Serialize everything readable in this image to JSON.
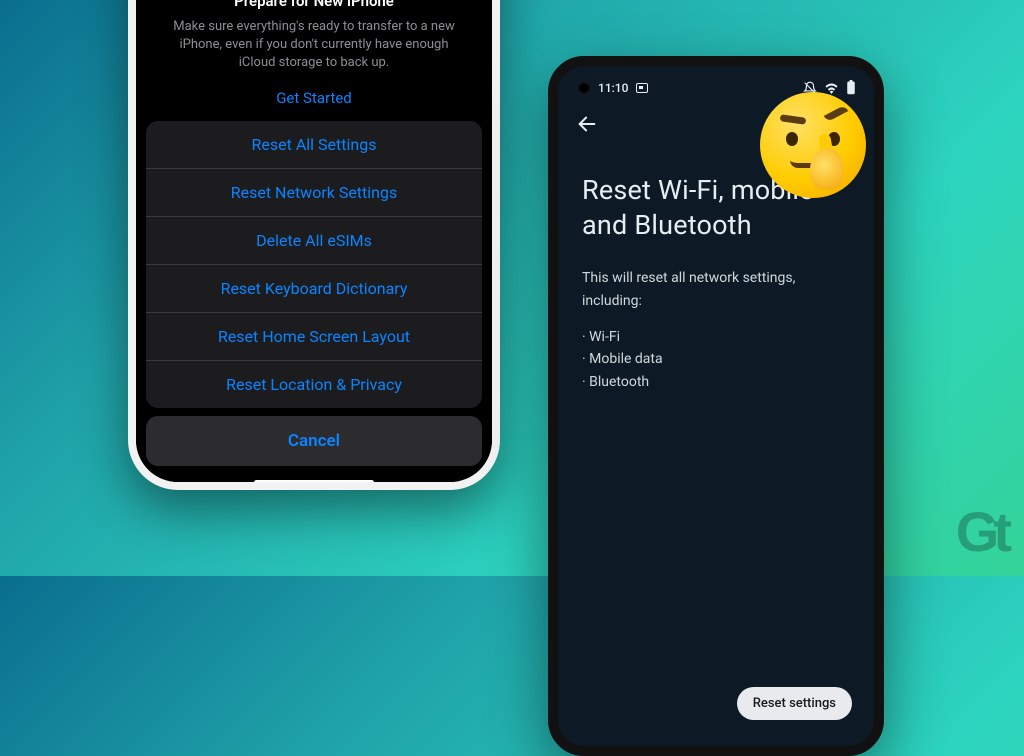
{
  "iphone": {
    "prepare_title": "Prepare for New iPhone",
    "prepare_desc": "Make sure everything's ready to transfer to a new iPhone, even if you don't currently have enough iCloud storage to back up.",
    "get_started": "Get Started",
    "options": [
      "Reset All Settings",
      "Reset Network Settings",
      "Delete All eSIMs",
      "Reset Keyboard Dictionary",
      "Reset Home Screen Layout",
      "Reset Location & Privacy"
    ],
    "cancel": "Cancel"
  },
  "android": {
    "time": "11:10",
    "headline": "Reset Wi-Fi, mobile and Bluetooth",
    "body_intro": "This will reset all network settings, including:",
    "bullets": [
      "Wi-Fi",
      "Mobile data",
      "Bluetooth"
    ],
    "reset_button": "Reset settings"
  },
  "logo": {
    "text": "Gt"
  }
}
